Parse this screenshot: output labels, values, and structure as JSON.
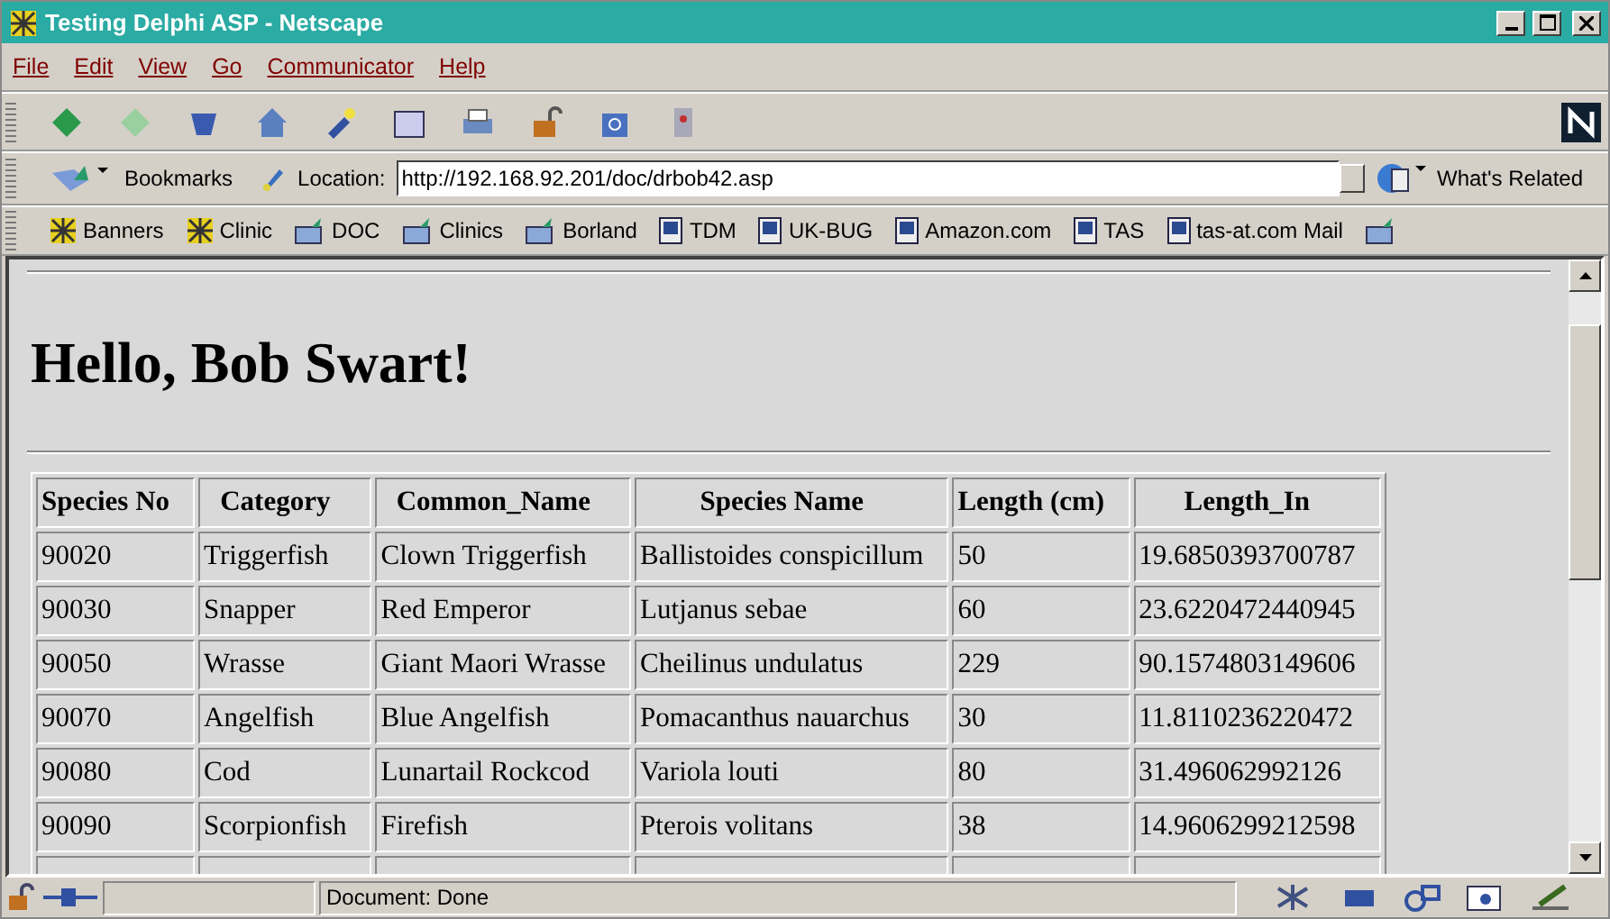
{
  "window": {
    "title": "Testing Delphi ASP - Netscape"
  },
  "menu": [
    "File",
    "Edit",
    "View",
    "Go",
    "Communicator",
    "Help"
  ],
  "location_bar": {
    "bookmarks": "Bookmarks",
    "label": "Location:",
    "url": "http://192.168.92.201/doc/drbob42.asp",
    "related": "What's Related"
  },
  "personal_toolbar": [
    {
      "kind": "netscape",
      "label": "Banners"
    },
    {
      "kind": "netscape",
      "label": "Clinic"
    },
    {
      "kind": "folder",
      "label": "DOC"
    },
    {
      "kind": "folder",
      "label": "Clinics"
    },
    {
      "kind": "folder",
      "label": "Borland"
    },
    {
      "kind": "page",
      "label": "TDM"
    },
    {
      "kind": "page",
      "label": "UK-BUG"
    },
    {
      "kind": "page",
      "label": "Amazon.com"
    },
    {
      "kind": "page",
      "label": "TAS"
    },
    {
      "kind": "page",
      "label": "tas-at.com Mail"
    },
    {
      "kind": "folder"
    }
  ],
  "page": {
    "heading": "Hello, Bob Swart!",
    "table": {
      "columns": [
        "Species No",
        "Category",
        "Common_Name",
        "Species Name",
        "Length (cm)",
        "Length_In"
      ],
      "rows": [
        [
          "90020",
          "Triggerfish",
          "Clown Triggerfish",
          "Ballistoides conspicillum",
          "50",
          "19.6850393700787"
        ],
        [
          "90030",
          "Snapper",
          "Red Emperor",
          "Lutjanus sebae",
          "60",
          "23.6220472440945"
        ],
        [
          "90050",
          "Wrasse",
          "Giant Maori Wrasse",
          "Cheilinus undulatus",
          "229",
          "90.1574803149606"
        ],
        [
          "90070",
          "Angelfish",
          "Blue Angelfish",
          "Pomacanthus nauarchus",
          "30",
          "11.8110236220472"
        ],
        [
          "90080",
          "Cod",
          "Lunartail Rockcod",
          "Variola louti",
          "80",
          "31.496062992126"
        ],
        [
          "90090",
          "Scorpionfish",
          "Firefish",
          "Pterois volitans",
          "38",
          "14.9606299212598"
        ]
      ]
    }
  },
  "status_bar": {
    "text": "Document: Done"
  }
}
